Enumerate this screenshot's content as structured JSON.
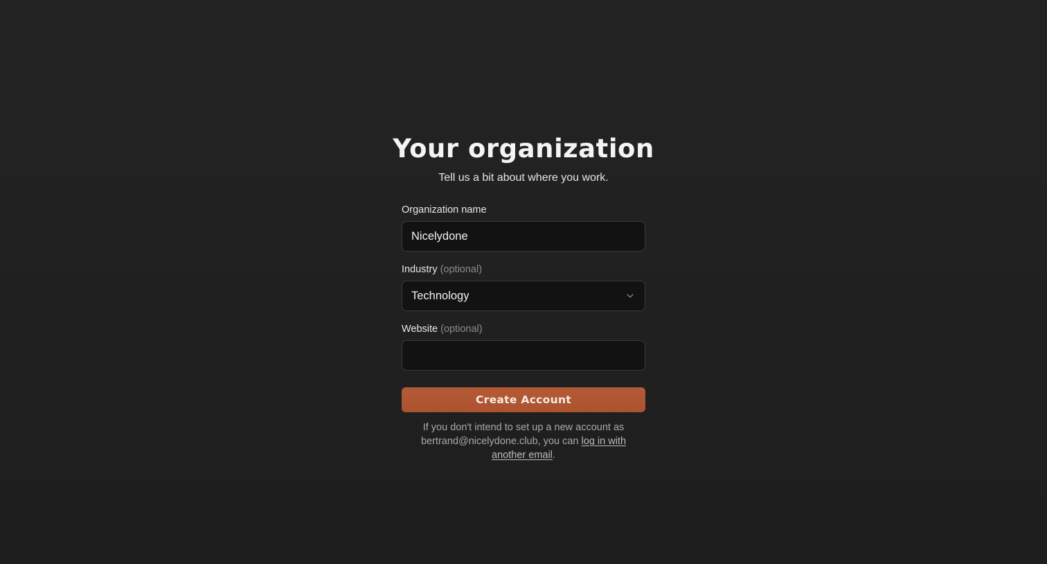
{
  "header": {
    "title": "Your organization",
    "subtitle": "Tell us a bit about where you work."
  },
  "form": {
    "organization_name": {
      "label": "Organization name",
      "value": "Nicelydone"
    },
    "industry": {
      "label": "Industry",
      "optional_tag": "(optional)",
      "selected": "Technology",
      "icon": "chevron-down-icon"
    },
    "website": {
      "label": "Website",
      "optional_tag": "(optional)",
      "value": "",
      "placeholder": ""
    },
    "submit_label": "Create Account"
  },
  "footer_note": {
    "text_before": "If you don't intend to set up a new account as bertrand@nicelydone.club, you can ",
    "link_text": "log in with another email",
    "text_after": "."
  },
  "colors": {
    "background": "#222222",
    "input_background": "#121212",
    "accent": "#b0552f"
  }
}
